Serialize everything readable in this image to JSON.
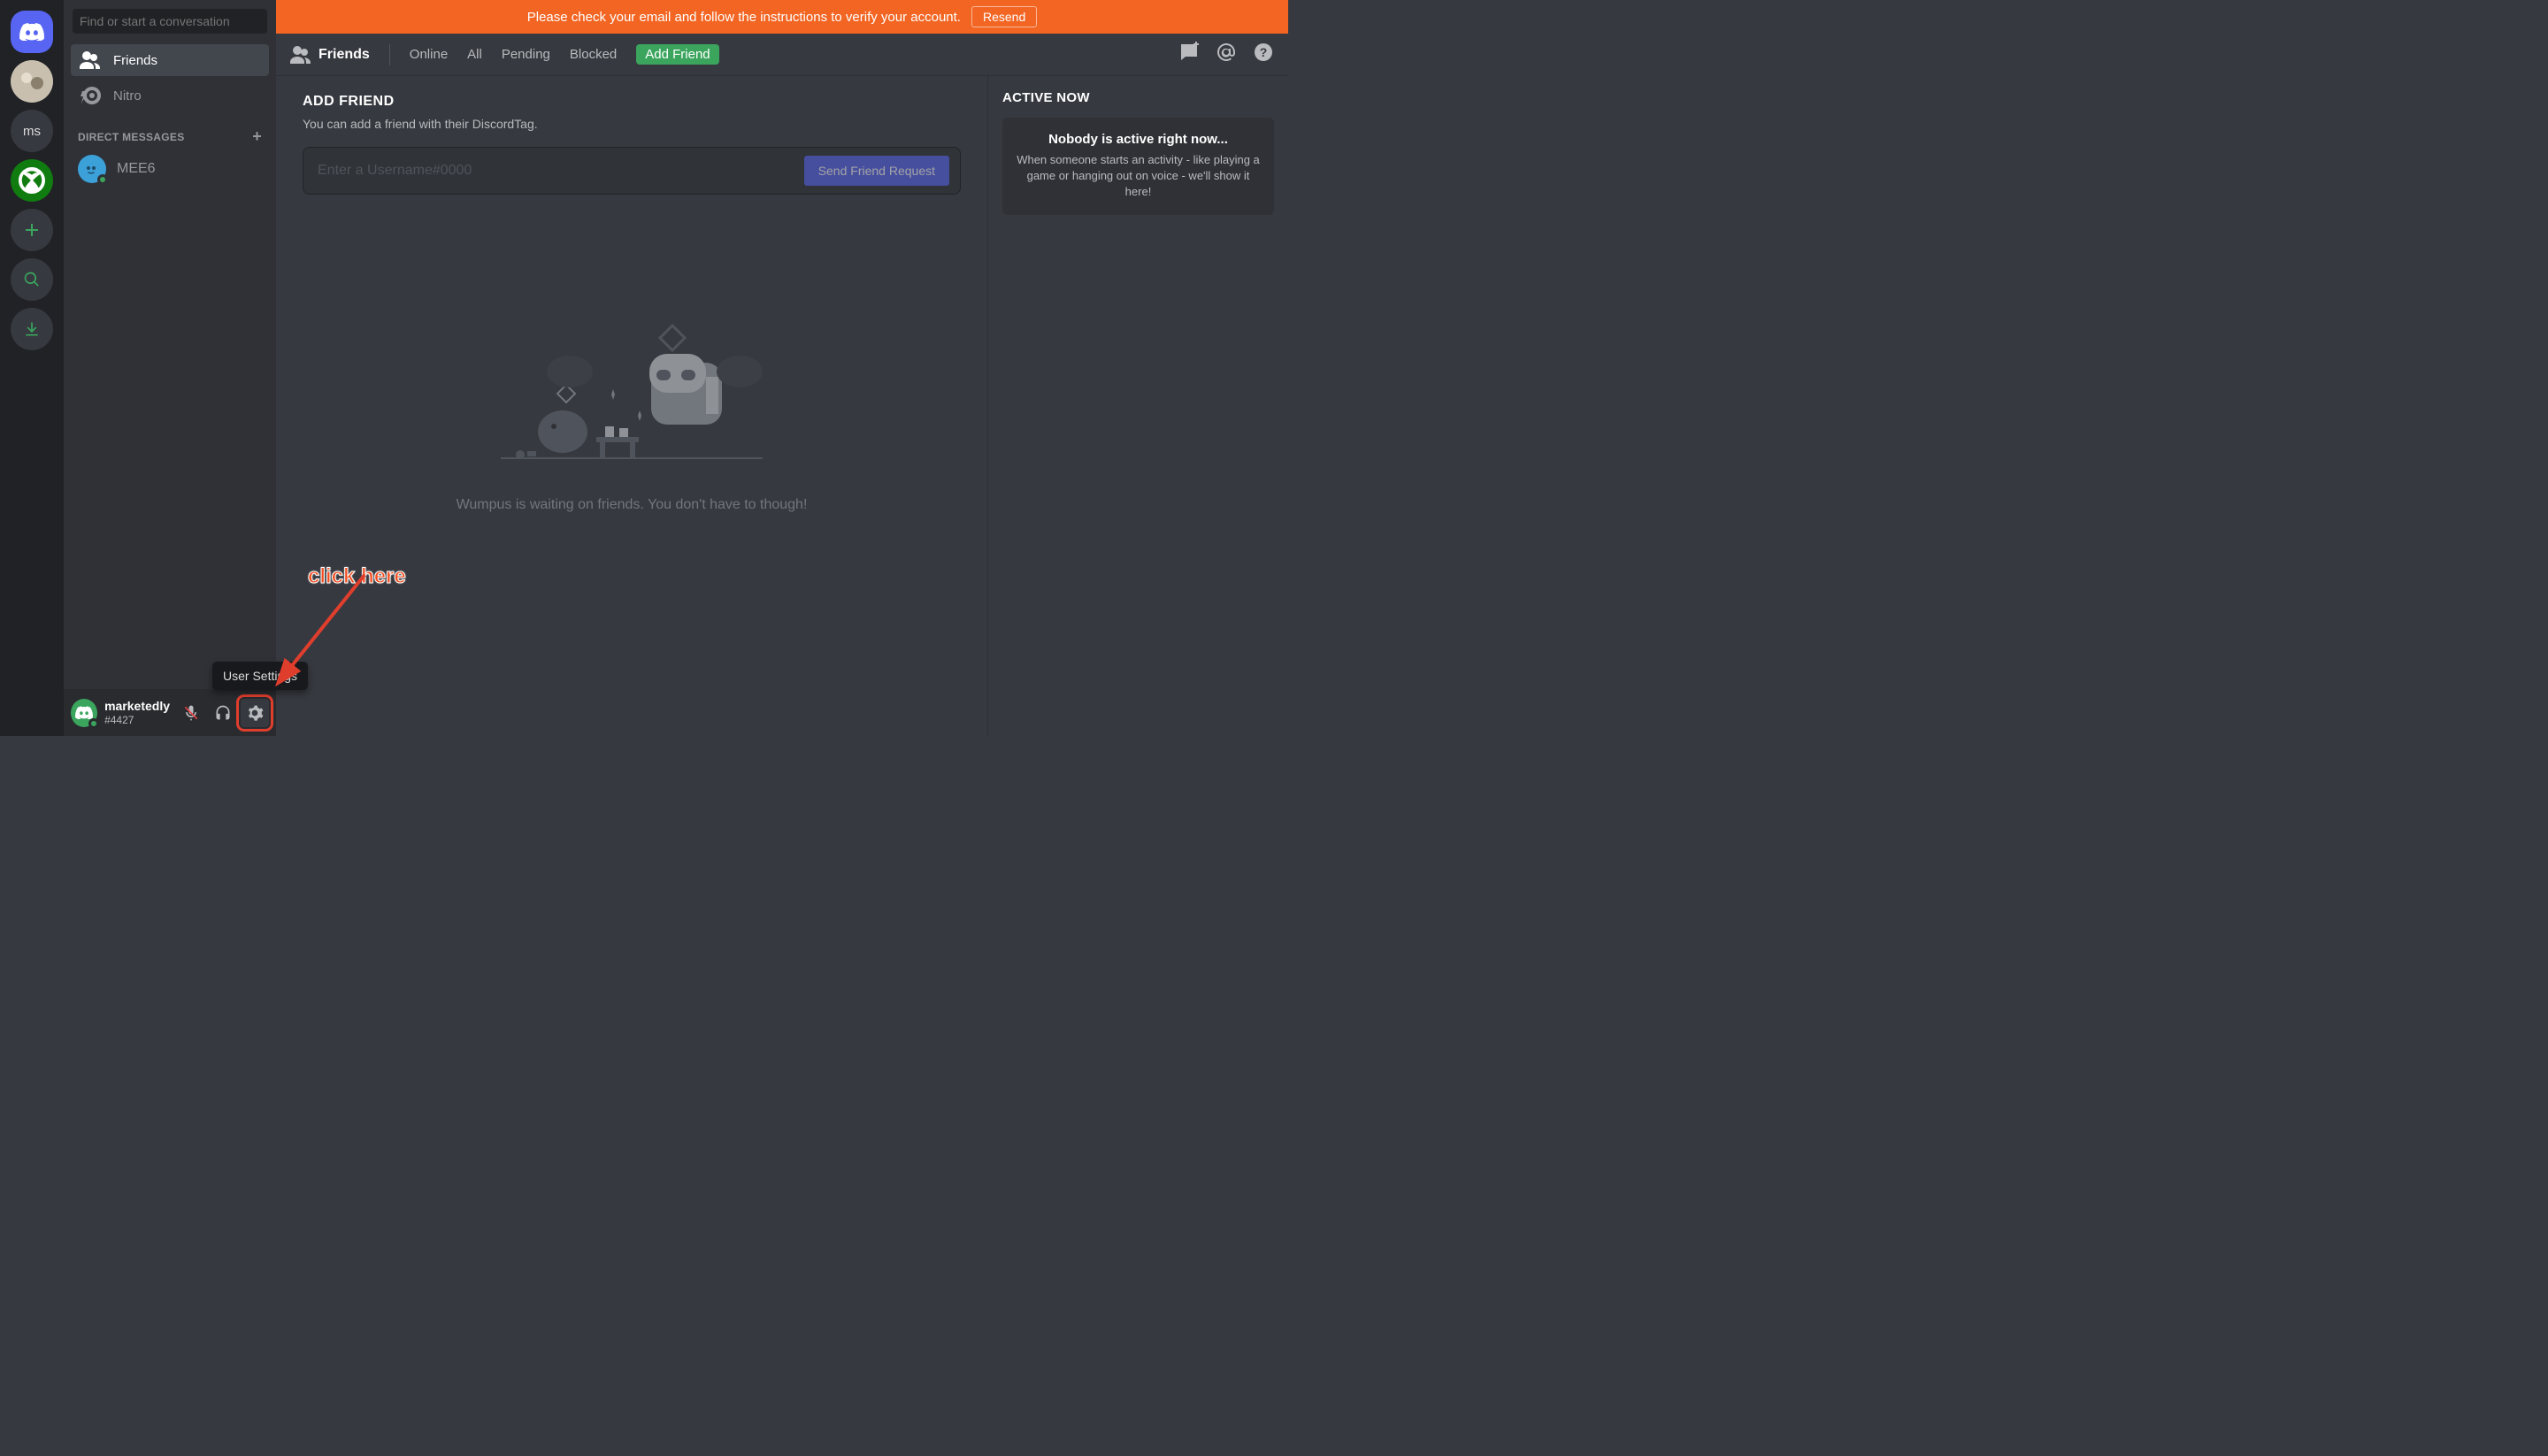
{
  "banner": {
    "text": "Please check your email and follow the instructions to verify your account.",
    "button": "Resend"
  },
  "server_rail": {
    "home_label": "Home",
    "servers": [
      {
        "kind": "avatar",
        "label": ""
      },
      {
        "kind": "text",
        "label": "ms"
      },
      {
        "kind": "xbox",
        "label": ""
      }
    ],
    "add_label": "+",
    "explore_label": "search",
    "download_label": "download"
  },
  "dm_panel": {
    "search_placeholder": "Find or start a conversation",
    "nav": [
      {
        "icon": "friends",
        "label": "Friends",
        "active": true
      },
      {
        "icon": "nitro",
        "label": "Nitro",
        "active": false
      }
    ],
    "dm_header": "DIRECT MESSAGES",
    "dms": [
      {
        "name": "MEE6"
      }
    ]
  },
  "topbar": {
    "title": "Friends",
    "tabs": [
      "Online",
      "All",
      "Pending",
      "Blocked"
    ],
    "add_tab": "Add Friend"
  },
  "add_friend": {
    "heading": "ADD FRIEND",
    "subtext": "You can add a friend with their DiscordTag.",
    "placeholder": "Enter a Username#0000",
    "button": "Send Friend Request"
  },
  "empty_state": {
    "text": "Wumpus is waiting on friends. You don't have to though!"
  },
  "active_now": {
    "heading": "Active Now",
    "card_title": "Nobody is active right now...",
    "card_body": "When someone starts an activity - like playing a game or hanging out on voice - we'll show it here!"
  },
  "user_panel": {
    "username": "marketedly",
    "tag": "#4427",
    "tooltip": "User Settings"
  },
  "annotation": {
    "label": "click here"
  },
  "colors": {
    "accent": "#5865f2",
    "banner": "#f26522",
    "positive": "#3ba55d",
    "annotation": "#e03e2d"
  }
}
